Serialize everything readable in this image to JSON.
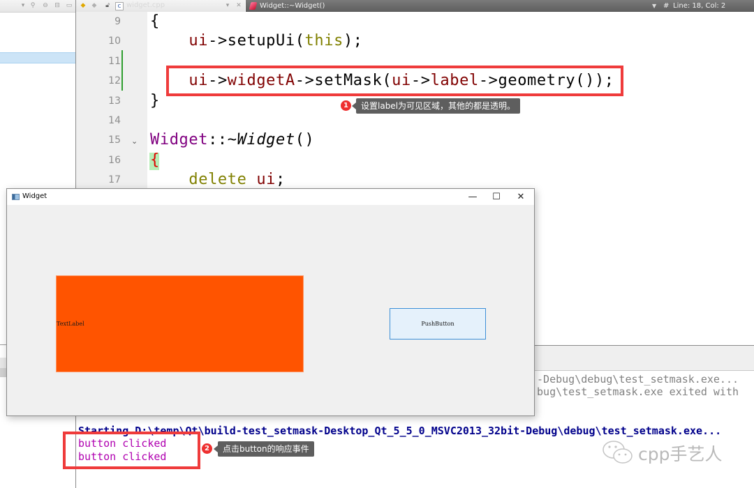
{
  "editor": {
    "file_name": "widget.cpp",
    "function_selector": "Widget::~Widget()",
    "position_label": "Line: 18, Col: 2",
    "hash_symbol": "#",
    "lines": [
      {
        "number": "9",
        "tokens": [
          {
            "t": "{",
            "c": ""
          }
        ]
      },
      {
        "number": "10",
        "tokens": [
          {
            "t": "    ",
            "c": ""
          },
          {
            "t": "ui",
            "c": "kw-ui"
          },
          {
            "t": "->setupUi(",
            "c": ""
          },
          {
            "t": "this",
            "c": "kw-this"
          },
          {
            "t": ");",
            "c": ""
          }
        ]
      },
      {
        "number": "11",
        "tokens": []
      },
      {
        "number": "12",
        "tokens": [
          {
            "t": "    ",
            "c": ""
          },
          {
            "t": "ui",
            "c": "kw-ui"
          },
          {
            "t": "->",
            "c": ""
          },
          {
            "t": "widgetA",
            "c": "kw-mem"
          },
          {
            "t": "->setMask(",
            "c": ""
          },
          {
            "t": "ui",
            "c": "kw-ui"
          },
          {
            "t": "->",
            "c": ""
          },
          {
            "t": "label",
            "c": "kw-mem"
          },
          {
            "t": "->geometry());",
            "c": ""
          }
        ]
      },
      {
        "number": "13",
        "tokens": [
          {
            "t": "}",
            "c": ""
          }
        ]
      },
      {
        "number": "14",
        "tokens": []
      },
      {
        "number": "15",
        "tokens": [
          {
            "t": "Widget",
            "c": "kw-cls"
          },
          {
            "t": "::~",
            "c": ""
          },
          {
            "t": "Widget",
            "c": "italic"
          },
          {
            "t": "()",
            "c": ""
          }
        ]
      },
      {
        "number": "16",
        "tokens": [
          {
            "t": "{",
            "c": "brace-match"
          }
        ]
      },
      {
        "number": "17",
        "tokens": [
          {
            "t": "    ",
            "c": ""
          },
          {
            "t": "delete",
            "c": "kw-del"
          },
          {
            "t": " ",
            "c": ""
          },
          {
            "t": "ui",
            "c": "kw-ui"
          },
          {
            "t": ";",
            "c": ""
          }
        ]
      }
    ]
  },
  "annotations": [
    {
      "number": "1",
      "text": "设置label为可见区域，其他的都是透明。"
    },
    {
      "number": "2",
      "text": "点击button的响应事件"
    }
  ],
  "widget_window": {
    "title": "Widget",
    "minimize": "—",
    "maximize": "☐",
    "close": "✕",
    "label_text": "TextLabel",
    "button_text": "PushButton"
  },
  "output": {
    "line_a": "-Debug\\debug\\test_setmask.exe...",
    "line_b": "bug\\test_setmask.exe exited with",
    "starting_line": "Starting D:\\temp\\Qt\\build-test_setmask-Desktop_Qt_5_5_0_MSVC2013_32bit-Debug\\debug\\test_setmask.exe...",
    "clicked_lines": [
      "button clicked",
      "button clicked"
    ]
  },
  "watermark": {
    "text": "cpp手艺人"
  },
  "colors": {
    "label_fill": "#ff5400",
    "highlight_box": "#ef3b3b",
    "output_blue": "#00008b",
    "output_magenta": "#b000b0"
  }
}
